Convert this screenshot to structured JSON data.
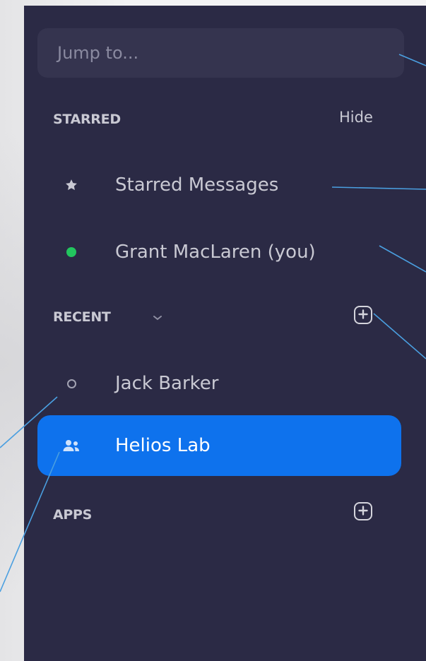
{
  "search": {
    "placeholder": "Jump to..."
  },
  "sections": {
    "starred": {
      "label": "STARRED",
      "hide_label": "Hide"
    },
    "recent": {
      "label": "RECENT"
    },
    "apps": {
      "label": "APPS"
    }
  },
  "items": {
    "starred_messages": "Starred Messages",
    "self_contact": "Grant MacLaren (you)",
    "jack_barker": "Jack Barker",
    "helios_lab": "Helios Lab"
  },
  "icons": {
    "star": "star-icon",
    "online": "online-status-icon",
    "offline": "offline-status-icon",
    "group": "group-icon",
    "add": "add-icon",
    "chevron": "chevron-down-icon"
  },
  "colors": {
    "sidebar_bg": "#2b2a45",
    "search_bg": "#35344f",
    "selected_bg": "#0e72ed",
    "online": "#22c55e",
    "callout_line": "#4a9fe0"
  }
}
